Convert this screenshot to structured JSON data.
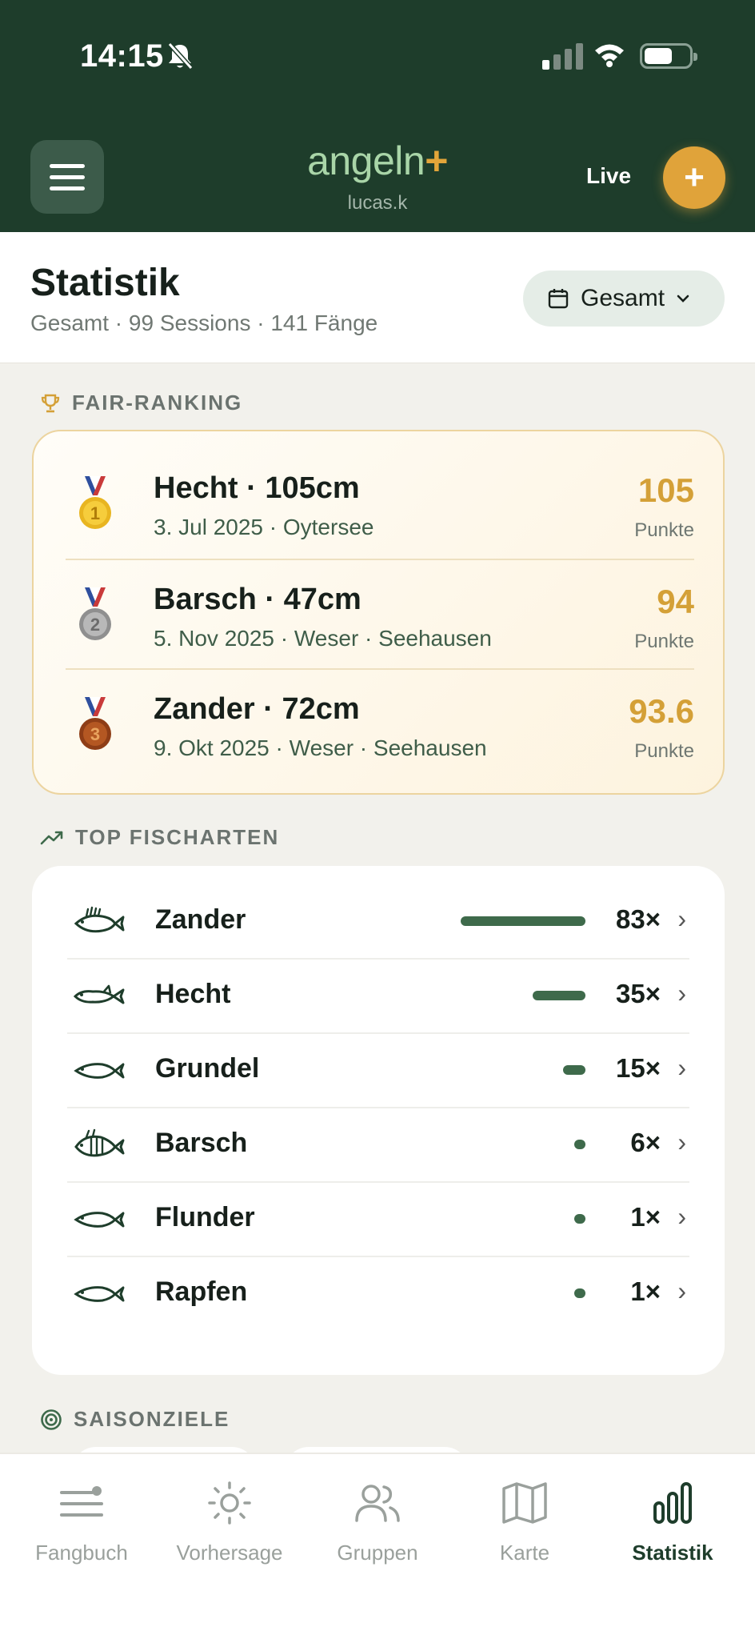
{
  "status_bar": {
    "time": "14:15"
  },
  "header": {
    "logo_text": "angeln",
    "logo_plus": "+",
    "username": "lucas.k",
    "live_label": "Live",
    "add_symbol": "+"
  },
  "page": {
    "title": "Statistik",
    "subtitle": "Gesamt · 99 Sessions · 141 Fänge",
    "period_label": "Gesamt"
  },
  "ranking": {
    "section_label": "FAIR-RANKING",
    "items": [
      {
        "rank": "1",
        "title": "Hecht · 105cm",
        "subtitle": "3. Jul 2025 · Oytersee",
        "points": "105",
        "points_label": "Punkte"
      },
      {
        "rank": "2",
        "title": "Barsch · 47cm",
        "subtitle": "5. Nov 2025 · Weser · Seehausen",
        "points": "94",
        "points_label": "Punkte"
      },
      {
        "rank": "3",
        "title": "Zander · 72cm",
        "subtitle": "9. Okt 2025 · Weser · Seehausen",
        "points": "93.6",
        "points_label": "Punkte"
      }
    ]
  },
  "top_species": {
    "section_label": "TOP FISCHARTEN",
    "items": [
      {
        "name": "Zander",
        "count_label": "83×",
        "count": 83,
        "icon": "zander-icon"
      },
      {
        "name": "Hecht",
        "count_label": "35×",
        "count": 35,
        "icon": "hecht-icon"
      },
      {
        "name": "Grundel",
        "count_label": "15×",
        "count": 15,
        "icon": "fish-icon"
      },
      {
        "name": "Barsch",
        "count_label": "6×",
        "count": 6,
        "icon": "barsch-icon"
      },
      {
        "name": "Flunder",
        "count_label": "1×",
        "count": 1,
        "icon": "fish-icon"
      },
      {
        "name": "Rapfen",
        "count_label": "1×",
        "count": 1,
        "icon": "fish-icon"
      }
    ]
  },
  "goals": {
    "section_label": "SAISONZIELE"
  },
  "tabs": [
    {
      "label": "Fangbuch",
      "icon": "logbook-icon",
      "active": false
    },
    {
      "label": "Vorhersage",
      "icon": "sun-icon",
      "active": false
    },
    {
      "label": "Gruppen",
      "icon": "users-icon",
      "active": false
    },
    {
      "label": "Karte",
      "icon": "map-icon",
      "active": false
    },
    {
      "label": "Statistik",
      "icon": "bar-chart-icon",
      "active": true
    }
  ],
  "colors": {
    "header_bg": "#1e3d2b",
    "accent_gold": "#e0a33a",
    "bar_green": "#3e6a4b"
  }
}
